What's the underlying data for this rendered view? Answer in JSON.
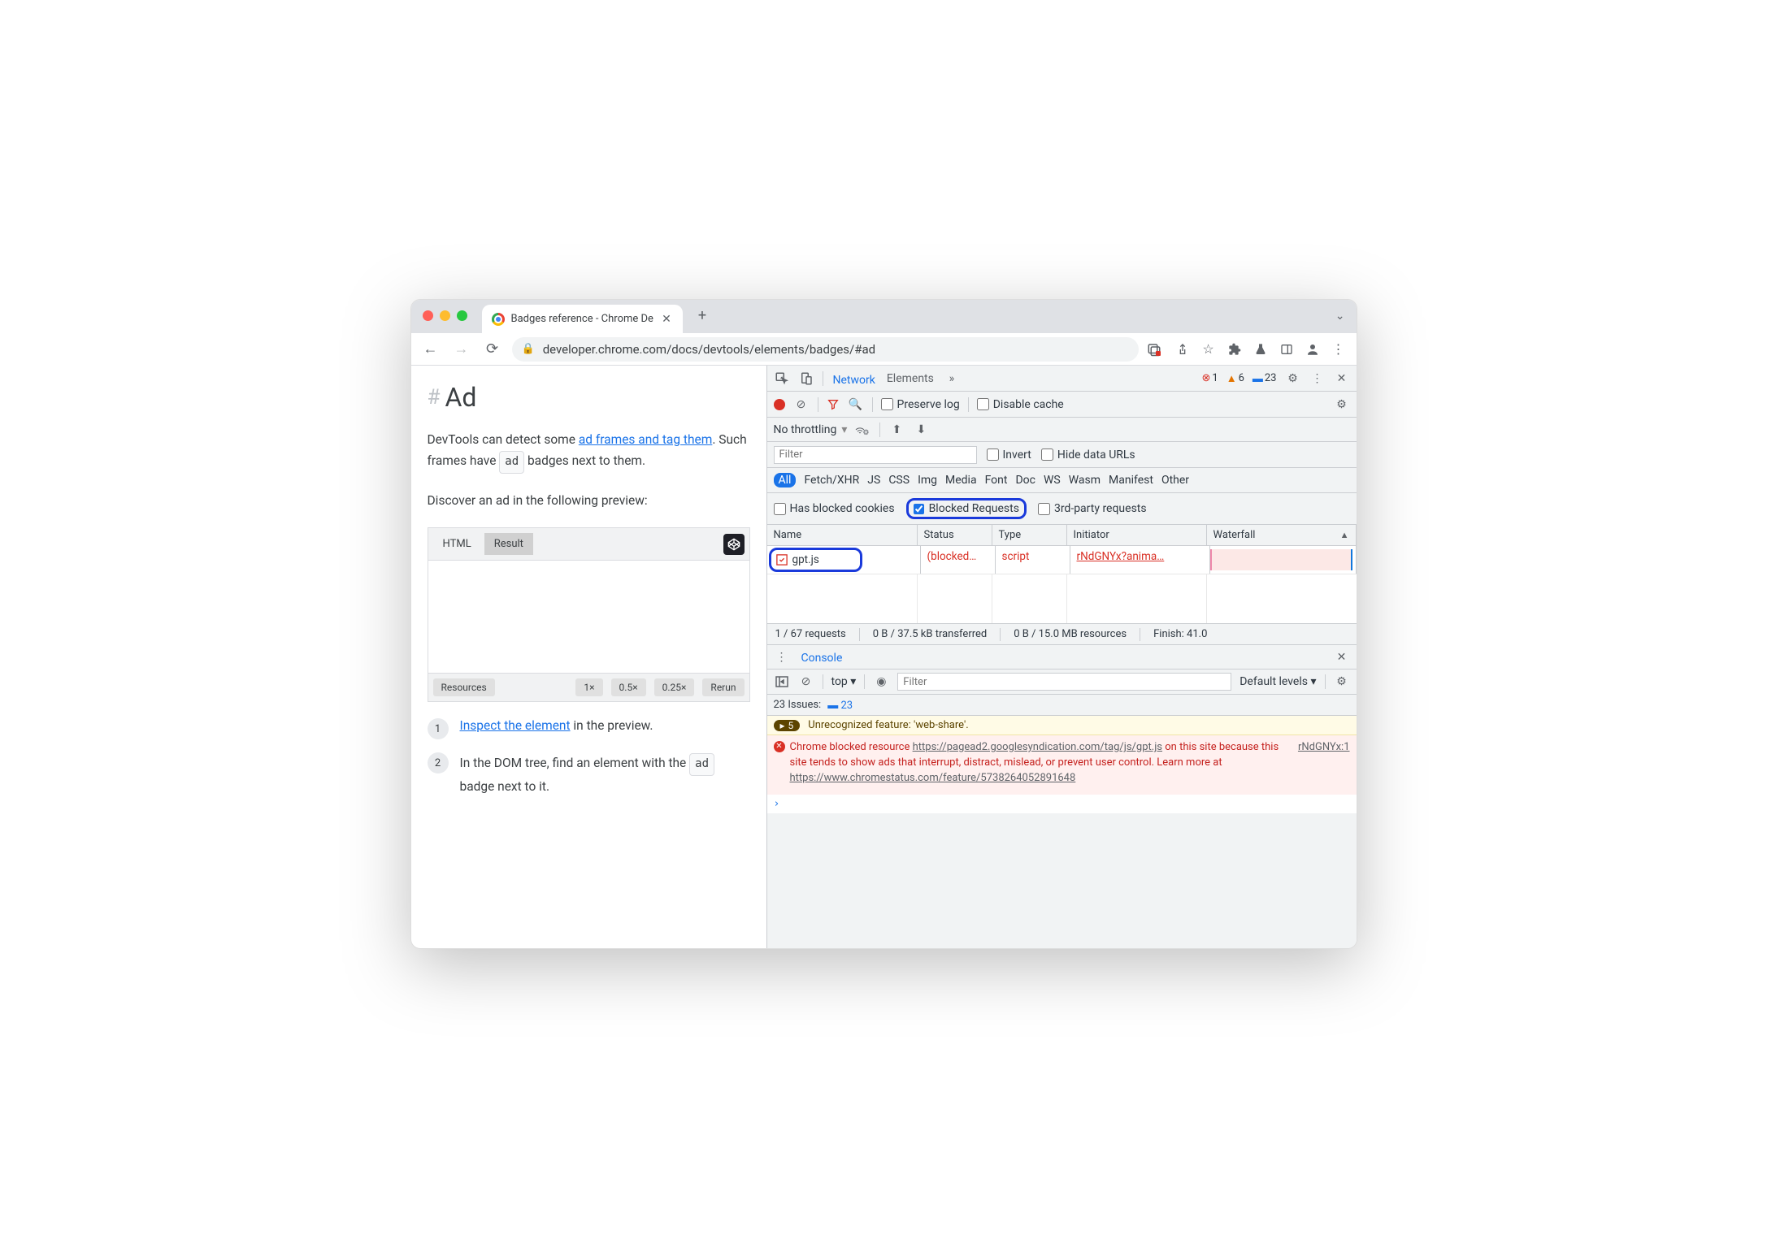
{
  "browser": {
    "tab_title": "Badges reference - Chrome De",
    "url": "developer.chrome.com/docs/devtools/elements/badges/#ad"
  },
  "page": {
    "hash": "#",
    "heading": "Ad",
    "para1_part1": "DevTools can detect some ",
    "para1_link": "ad frames and tag them",
    "para1_part2": ". Such frames have ",
    "para1_badge": "ad",
    "para1_part3": " badges next to them.",
    "para2": "Discover an ad in the following preview:",
    "codepen": {
      "tab_html": "HTML",
      "tab_result": "Result",
      "foot_resources": "Resources",
      "foot_1x": "1×",
      "foot_05x": "0.5×",
      "foot_025x": "0.25×",
      "foot_rerun": "Rerun"
    },
    "step1_link": "Inspect the element",
    "step1_rest": " in the preview.",
    "step2_part1": "In the DOM tree, find an element with the ",
    "step2_badge": "ad",
    "step2_part2": " badge next to it."
  },
  "devtools": {
    "tabs": {
      "network": "Network",
      "elements": "Elements"
    },
    "counts": {
      "errors": "1",
      "warnings": "6",
      "info": "23"
    },
    "toolbar": {
      "preserve_log": "Preserve log",
      "disable_cache": "Disable cache",
      "no_throttling": "No throttling"
    },
    "filter": {
      "placeholder": "Filter",
      "invert": "Invert",
      "hide_data_urls": "Hide data URLs"
    },
    "types": [
      "All",
      "Fetch/XHR",
      "JS",
      "CSS",
      "Img",
      "Media",
      "Font",
      "Doc",
      "WS",
      "Wasm",
      "Manifest",
      "Other"
    ],
    "checks": {
      "has_blocked_cookies": "Has blocked cookies",
      "blocked_requests": "Blocked Requests",
      "third_party": "3rd-party requests"
    },
    "columns": {
      "name": "Name",
      "status": "Status",
      "type": "Type",
      "initiator": "Initiator",
      "waterfall": "Waterfall"
    },
    "row": {
      "name": "gpt.js",
      "status": "(blocked…",
      "type": "script",
      "initiator": "rNdGNYx?anima…"
    },
    "status": {
      "requests": "1 / 67 requests",
      "transferred": "0 B / 37.5 kB transferred",
      "resources": "0 B / 15.0 MB resources",
      "finish": "Finish: 41.0"
    },
    "console": {
      "title": "Console",
      "top": "top ▾",
      "filter_placeholder": "Filter",
      "default_levels": "Default levels ▾",
      "issues_label": "23 Issues:",
      "issues_count": "23",
      "warn_count": "5",
      "warn_text": "Unrecognized feature: 'web-share'.",
      "err_prefix": "Chrome blocked resource ",
      "err_url": "https://pagead2.googlesyndication.com/tag/js/gpt.js",
      "err_mid": " on this site because this site tends to show ads that interrupt, distract, mislead, or prevent user control. Learn more at ",
      "err_learn": "https://www.chromestatus.com/feature/5738264052891648",
      "err_src": "rNdGNYx:1"
    }
  }
}
